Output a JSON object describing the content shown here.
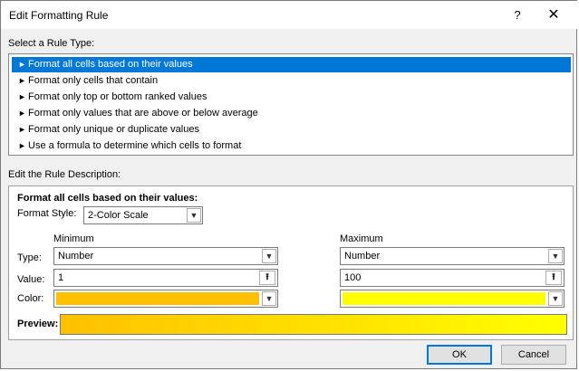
{
  "window": {
    "title": "Edit Formatting Rule",
    "help_label": "?",
    "close_label": "✕"
  },
  "rule_type": {
    "section_label": "Select a Rule Type:",
    "items": [
      {
        "label": "Format all cells based on their values",
        "selected": true
      },
      {
        "label": "Format only cells that contain",
        "selected": false
      },
      {
        "label": "Format only top or bottom ranked values",
        "selected": false
      },
      {
        "label": "Format only values that are above or below average",
        "selected": false
      },
      {
        "label": "Format only unique or duplicate values",
        "selected": false
      },
      {
        "label": "Use a formula to determine which cells to format",
        "selected": false
      }
    ],
    "bullet": "►"
  },
  "description": {
    "section_label": "Edit the Rule Description:",
    "heading": "Format all cells based on their values:",
    "format_style_label": "Format Style:",
    "format_style_value": "2-Color Scale",
    "minimum_label": "Minimum",
    "maximum_label": "Maximum",
    "type_label": "Type:",
    "value_label": "Value:",
    "color_label": "Color:",
    "min_type": "Number",
    "max_type": "Number",
    "min_value": "1",
    "max_value": "100",
    "min_color": "#ffc000",
    "max_color": "#ffff00",
    "preview_label": "Preview:"
  },
  "buttons": {
    "ok": "OK",
    "cancel": "Cancel"
  },
  "icons": {
    "dropdown": "chevron-down-icon",
    "ref": "collapse-dialog-icon",
    "close": "close-icon",
    "help": "help-icon"
  }
}
